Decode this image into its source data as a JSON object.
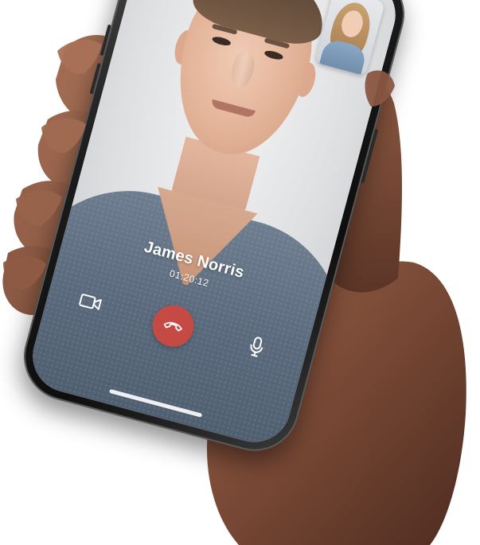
{
  "call": {
    "caller_name": "James Norris",
    "duration": "01:20:12"
  },
  "controls": {
    "video_icon": "video-camera-icon",
    "end_call_icon": "phone-hangup-icon",
    "mic_icon": "microphone-icon"
  },
  "colors": {
    "end_call": "#c64a44",
    "shirt": "#5a6a7c",
    "text": "#ffffff"
  }
}
